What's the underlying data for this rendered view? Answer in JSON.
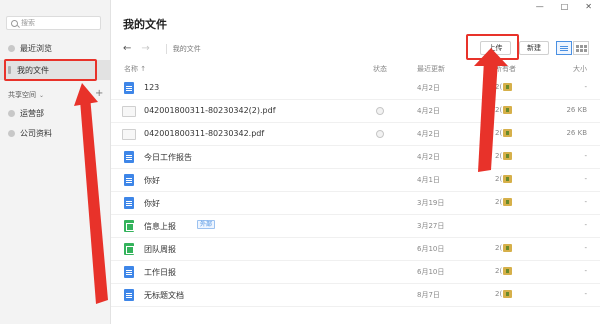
{
  "sidebar": {
    "search_placeholder": "搜索",
    "items": [
      {
        "label": "最近浏览"
      },
      {
        "label": "我的文件"
      }
    ],
    "section": {
      "label": "共享空间",
      "chevron": "⌄",
      "add": "+"
    },
    "shared_items": [
      {
        "label": "运营部"
      },
      {
        "label": "公司资料"
      }
    ]
  },
  "window": {
    "minimize": "—",
    "maximize": "□",
    "close": "✕"
  },
  "main": {
    "title": "我的文件",
    "back": "←",
    "forward": "→",
    "breadcrumb": "我的文件",
    "upload_label": "上传",
    "new_label": "新建"
  },
  "table": {
    "headers": {
      "name": "名称",
      "sort": "↑",
      "status": "状态",
      "modified": "最近更新",
      "creator": "所有者",
      "size": "大小"
    },
    "rows": [
      {
        "name": "123",
        "icon": "doc-icon",
        "status": "",
        "date": "4月2日",
        "creator": "2(",
        "size": "-"
      },
      {
        "name": "042001800311-80230342(2).pdf",
        "icon": "pdf-icon",
        "status": "sync",
        "date": "4月2日",
        "creator": "2(",
        "size": "26 KB"
      },
      {
        "name": "042001800311-80230342.pdf",
        "icon": "pdf-icon",
        "status": "sync",
        "date": "4月2日",
        "creator": "2(",
        "size": "26 KB"
      },
      {
        "name": "今日工作报告",
        "icon": "doc-icon",
        "status": "",
        "date": "4月2日",
        "creator": "2(",
        "size": "-"
      },
      {
        "name": "你好",
        "icon": "doc-icon",
        "status": "",
        "date": "4月1日",
        "creator": "2(",
        "size": "-"
      },
      {
        "name": "你好",
        "icon": "doc-icon",
        "status": "",
        "date": "3月19日",
        "creator": "2(",
        "size": "-"
      },
      {
        "name": "信息上报",
        "icon": "sheet-icon",
        "tag": "外部",
        "status": "",
        "date": "3月27日",
        "creator": "",
        "size": "-"
      },
      {
        "name": "团队周报",
        "icon": "sheet-icon",
        "status": "",
        "date": "6月10日",
        "creator": "2(",
        "size": "-"
      },
      {
        "name": "工作日报",
        "icon": "doc-icon",
        "status": "",
        "date": "6月10日",
        "creator": "2(",
        "size": "-"
      },
      {
        "name": "无标题文档",
        "icon": "doc-icon",
        "status": "",
        "date": "8月7日",
        "creator": "2(",
        "size": "-"
      }
    ]
  },
  "colors": {
    "accent": "#4a90e2",
    "highlight": "#e8322a",
    "doc": "#3e86e8",
    "sheet": "#34b35c"
  }
}
